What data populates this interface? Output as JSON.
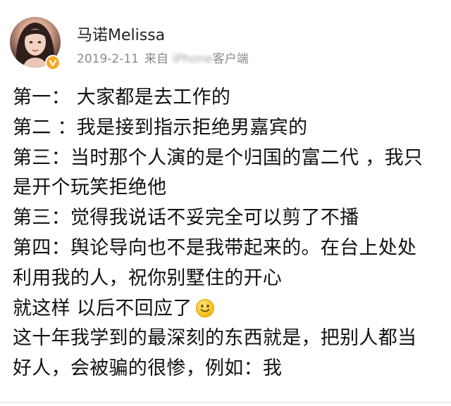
{
  "post": {
    "author": {
      "name": "马诺Melissa",
      "verified": true
    },
    "meta": {
      "date": "2019-2-11",
      "source_prefix": "来自",
      "source_blurred": "iPhone",
      "source_suffix": "客户端"
    },
    "lines": [
      "第一：  大家都是去工作的",
      "第二 ：我是接到指示拒绝男嘉宾的",
      "第三：当时那个人演的是个归国的富二代 ，我只",
      "是开个玩笑拒绝他",
      "第三：觉得我说话不妥完全可以剪了不播",
      "第四：舆论导向也不是我带起来的。在台上处处",
      "利用我的人，祝你别墅住的开心",
      "就这样 以后不回应了",
      "这十年我学到的最深刻的东西就是，把别人都当",
      "好人，会被骗的很惨，例如：我"
    ],
    "emoji": "smile-icon"
  },
  "colors": {
    "text": "#111111",
    "meta": "#8a8a8a",
    "badge": "#f5a623"
  }
}
